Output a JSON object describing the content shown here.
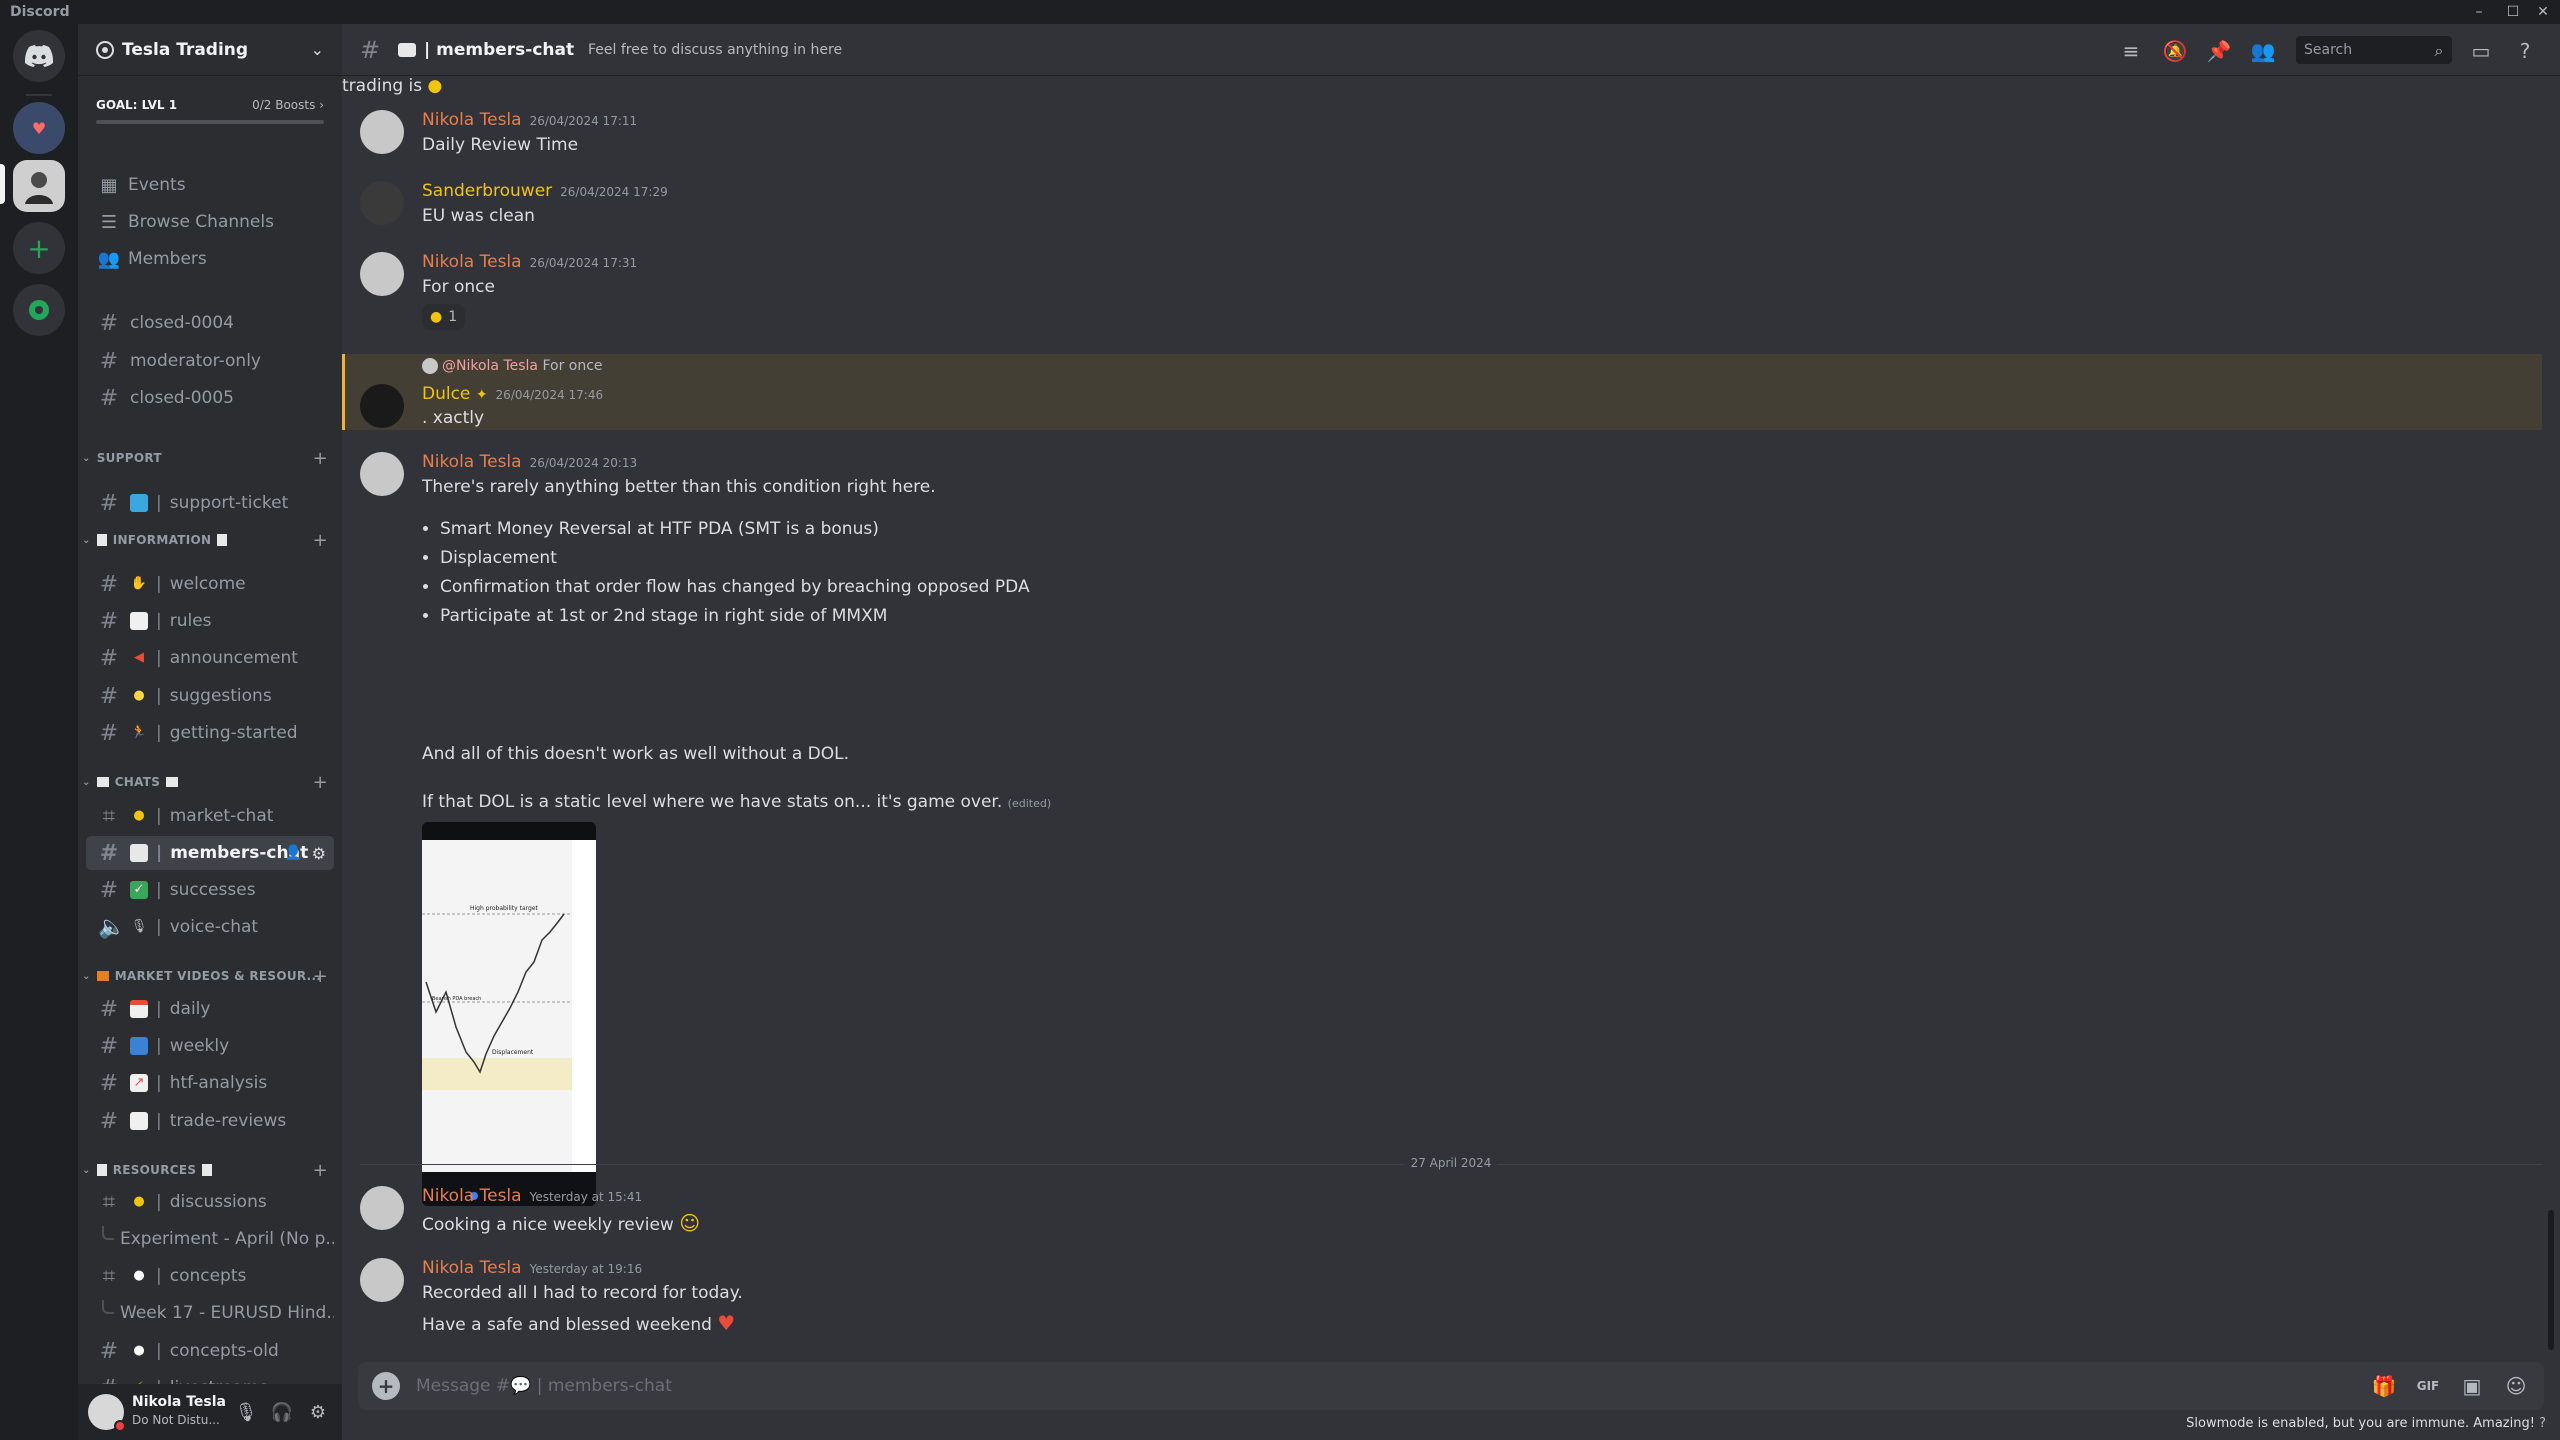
{
  "app": {
    "title": "Discord"
  },
  "server": {
    "name": "Tesla Trading",
    "goal_label": "GOAL: LVL 1",
    "boosts": "0/2 Boosts",
    "boost_progress": 0
  },
  "nav": {
    "events": "Events",
    "browse": "Browse Channels",
    "members": "Members"
  },
  "channels_top": [
    "closed-0004",
    "moderator-only",
    "closed-0005"
  ],
  "categories": {
    "support": "SUPPORT",
    "information": "INFORMATION",
    "chats": "CHATS",
    "videos": "MARKET VIDEOS & RESOUR...",
    "resources": "RESOURCES"
  },
  "channels": {
    "support_ticket": "support-ticket",
    "welcome": "welcome",
    "rules": "rules",
    "announcement": "announcement",
    "suggestions": "suggestions",
    "getting_started": "getting-started",
    "market_chat": "market-chat",
    "members_chat": "members-chat",
    "successes": "successes",
    "voice_chat": "voice-chat",
    "daily": "daily",
    "weekly": "weekly",
    "htf_analysis": "htf-analysis",
    "trade_reviews": "trade-reviews",
    "discussions": "discussions",
    "thread_experiment": "Experiment - April (No p...",
    "concepts": "concepts",
    "thread_week17": "Week 17 - EURUSD Hind...",
    "concepts_old": "concepts-old",
    "livestreams": "livestreams"
  },
  "user": {
    "name": "Nikola Tesla",
    "status": "Do Not Distu..."
  },
  "header": {
    "channel": "members-chat",
    "topic": "Feel free to discuss anything in here",
    "search_placeholder": "Search"
  },
  "messages": {
    "partial_top": "trading is",
    "m1": {
      "author": "Nikola Tesla",
      "ts": "26/04/2024 17:11",
      "text": "Daily Review Time"
    },
    "m2": {
      "author": "Sanderbrouwer",
      "ts": "26/04/2024 17:29",
      "text": "EU was clean"
    },
    "m3": {
      "author": "Nikola Tesla",
      "ts": "26/04/2024 17:31",
      "text": "For once",
      "reaction_count": "1"
    },
    "m4": {
      "reply_mention": "@Nikola Tesla",
      "reply_text": "For once",
      "author": "Dulce",
      "ts": "26/04/2024 17:46",
      "text": ". xactly"
    },
    "m5": {
      "author": "Nikola Tesla",
      "ts": "26/04/2024 20:13",
      "text1": "There's rarely anything better than this condition right here.",
      "bullets": [
        "Smart Money Reversal at HTF PDA (SMT is a bonus)",
        "Displacement",
        "Confirmation that order flow has changed by breaching opposed PDA",
        "Participate at 1st or 2nd stage in right side of MMXM"
      ],
      "text2": "And all of this doesn't work as well without a DOL.",
      "text3": "If that DOL is a static level where we have stats on... it's game over.",
      "edited": "(edited)",
      "chart_labels": {
        "top": "High probability target",
        "mid": "Bearish PDA breach",
        "low": "Displacement"
      }
    },
    "date_divider": "27 April 2024",
    "m6": {
      "author": "Nikola Tesla",
      "ts": "Yesterday at 15:41",
      "text": "Cooking a nice weekly review"
    },
    "m7": {
      "author": "Nikola Tesla",
      "ts": "Yesterday at 19:16",
      "text1": "Recorded all I had to record for today.",
      "text2": "Have a safe and blessed weekend"
    }
  },
  "composer": {
    "placeholder": "Message #💬 | members-chat"
  },
  "footer": {
    "slowmode": "Slowmode is enabled, but you are immune. Amazing!"
  },
  "colors": {
    "accent_orange": "#e67e4f",
    "author_yellow": "#f1c40f",
    "highlight_border": "#f0b232",
    "dnd_red": "#f23f43"
  }
}
